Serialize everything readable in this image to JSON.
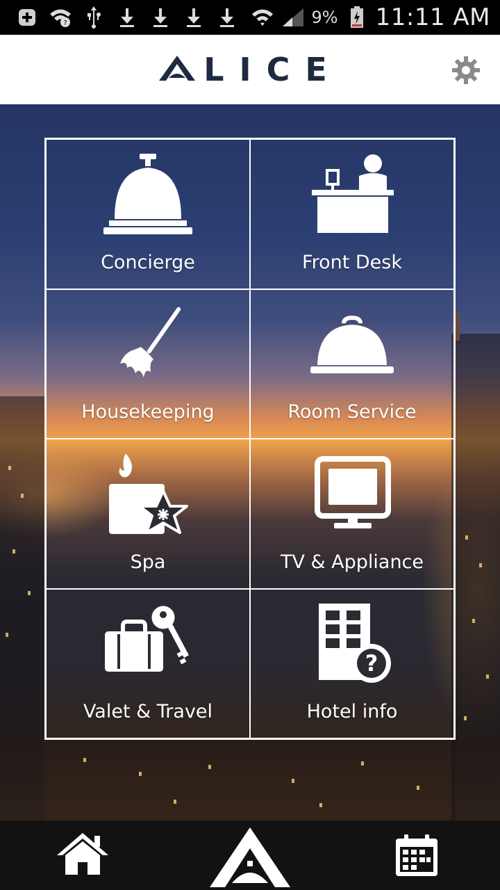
{
  "status_bar": {
    "battery_percent": "9%",
    "time": "11:11 AM",
    "icons": [
      "add-notification-icon",
      "wifi-question-icon",
      "usb-icon",
      "download-icon",
      "download-icon",
      "download-icon",
      "download-icon",
      "wifi-icon",
      "signal-icon",
      "battery-charging-icon"
    ]
  },
  "header": {
    "logo_text": "LICE",
    "settings_icon": "gear-icon"
  },
  "tiles": [
    {
      "label": "Concierge",
      "icon": "service-bell-icon"
    },
    {
      "label": "Front Desk",
      "icon": "front-desk-icon"
    },
    {
      "label": "Housekeeping",
      "icon": "duster-icon"
    },
    {
      "label": "Room Service",
      "icon": "cloche-icon"
    },
    {
      "label": "Spa",
      "icon": "candle-flower-icon"
    },
    {
      "label": "TV & Appliance",
      "icon": "television-icon"
    },
    {
      "label": "Valet & Travel",
      "icon": "luggage-key-icon"
    },
    {
      "label": "Hotel info",
      "icon": "building-question-icon"
    }
  ],
  "bottom_nav": {
    "items": [
      "home-icon",
      "alice-logo-icon",
      "calendar-icon"
    ]
  },
  "colors": {
    "brand_navy": "#1d2a40",
    "header_bg": "#ffffff",
    "nav_bg": "#121212",
    "tile_border": "#ffffff"
  }
}
